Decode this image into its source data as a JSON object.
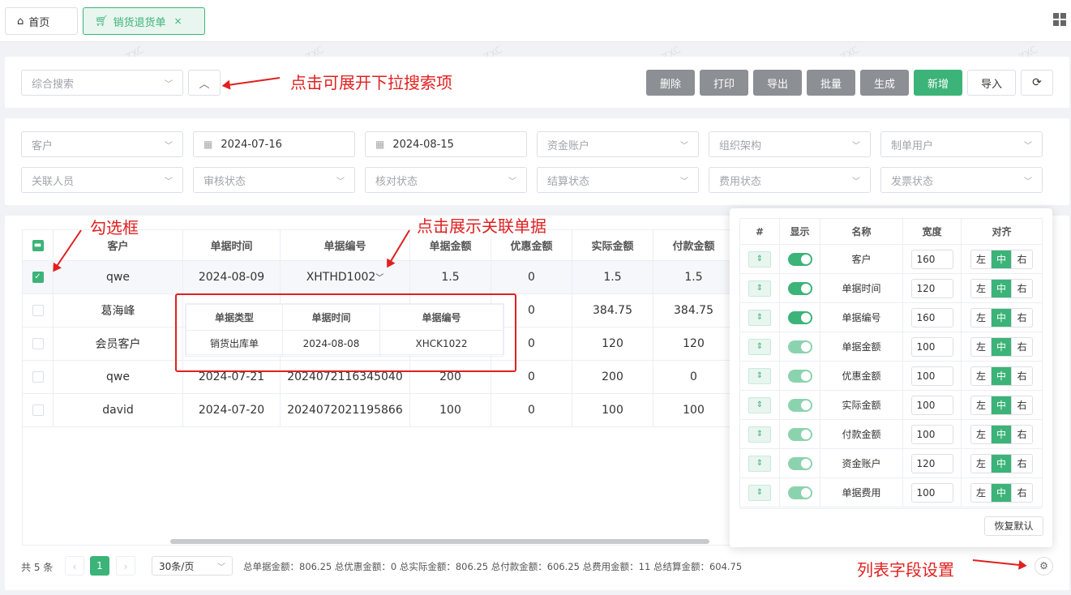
{
  "tabs": [
    {
      "label": "首页",
      "icon": "home-icon",
      "active": false
    },
    {
      "label": "销货退货单",
      "icon": "cart-icon",
      "active": true,
      "close": "×"
    }
  ],
  "toolbar": {
    "search_placeholder": "综合搜索",
    "buttons": {
      "delete": "删除",
      "print": "打印",
      "export": "导出",
      "batch": "批量",
      "generate": "生成",
      "add": "新增",
      "import": "导入"
    }
  },
  "filters": {
    "customer": "客户",
    "date_start": "2024-07-16",
    "date_end": "2024-08-15",
    "fund_account": "资金账户",
    "org": "组织架构",
    "creator": "制单用户",
    "related_person": "关联人员",
    "audit_status": "审核状态",
    "check_status": "核对状态",
    "settle_status": "结算状态",
    "fee_status": "费用状态",
    "invoice_status": "发票状态"
  },
  "table": {
    "headers": [
      "客户",
      "单据时间",
      "单据编号",
      "单据金额",
      "优惠金额",
      "实际金额",
      "付款金额"
    ],
    "rows": [
      {
        "checked": true,
        "cells": [
          "qwe",
          "2024-08-09",
          "XHTHD1002",
          "1.5",
          "0",
          "1.5",
          "1.5"
        ]
      },
      {
        "checked": false,
        "cells": [
          "葛海峰",
          "",
          "",
          "",
          "0",
          "384.75",
          "384.75"
        ]
      },
      {
        "checked": false,
        "cells": [
          "会员客户",
          "",
          "",
          "",
          "0",
          "120",
          "120"
        ]
      },
      {
        "checked": false,
        "cells": [
          "qwe",
          "2024-07-21",
          "2024072116345040",
          "200",
          "0",
          "200",
          "0"
        ]
      },
      {
        "checked": false,
        "cells": [
          "david",
          "2024-07-20",
          "2024072021195866",
          "100",
          "0",
          "100",
          "100"
        ]
      }
    ]
  },
  "popup": {
    "headers": [
      "单据类型",
      "单据时间",
      "单据编号"
    ],
    "row": [
      "销货出库单",
      "2024-08-08",
      "XHCK1022"
    ]
  },
  "column_settings": {
    "headers": [
      "#",
      "显示",
      "名称",
      "宽度",
      "对齐"
    ],
    "rows": [
      {
        "name": "客户",
        "width": "160",
        "bright": true
      },
      {
        "name": "单据时间",
        "width": "120",
        "bright": true
      },
      {
        "name": "单据编号",
        "width": "160",
        "bright": true
      },
      {
        "name": "单据金额",
        "width": "100",
        "bright": false
      },
      {
        "name": "优惠金额",
        "width": "100",
        "bright": false
      },
      {
        "name": "实际金额",
        "width": "100",
        "bright": false
      },
      {
        "name": "付款金额",
        "width": "100",
        "bright": false
      },
      {
        "name": "资金账户",
        "width": "120",
        "bright": false
      },
      {
        "name": "单据费用",
        "width": "100",
        "bright": false
      }
    ],
    "align": [
      "左",
      "中",
      "右"
    ],
    "reset": "恢复默认"
  },
  "footer": {
    "total": "共 5 条",
    "page": "1",
    "page_size": "30条/页",
    "sums": "总单据金额：806.25 总优惠金额：0 总实际金额：806.25 总付款金额：606.25 总费用金额：11 总结算金额：604.75"
  },
  "annotations": {
    "expand": "点击可展开下拉搜索项",
    "checkbox": "勾选框",
    "related": "点击展示关联单据",
    "fields": "列表字段设置"
  },
  "watermark": "@ZXC",
  "colors": {
    "accent": "#3cb378",
    "annotation": "#e02020",
    "gray_button": "#8c8f93"
  }
}
